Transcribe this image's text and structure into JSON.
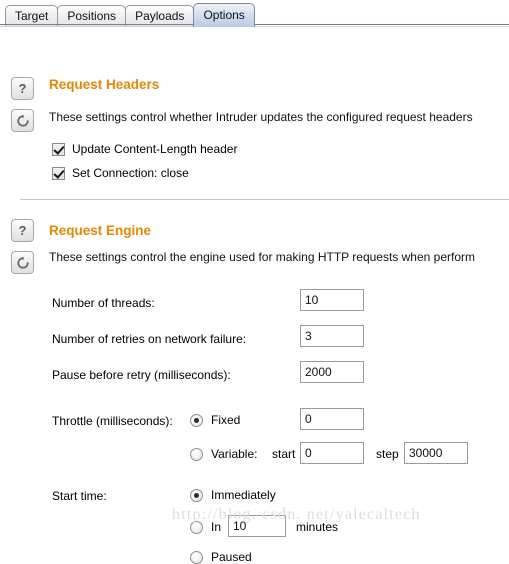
{
  "tabs": [
    {
      "label": "Target",
      "selected": false
    },
    {
      "label": "Positions",
      "selected": false
    },
    {
      "label": "Payloads",
      "selected": false
    },
    {
      "label": "Options",
      "selected": true
    }
  ],
  "icons": {
    "help": "?",
    "help_name": "help-question-icon",
    "reset_name": "refresh-reset-icon"
  },
  "request_headers": {
    "title": "Request Headers",
    "description": "These settings control whether Intruder updates the configured request headers",
    "checkboxes": [
      {
        "label": "Update Content-Length header",
        "checked": true
      },
      {
        "label": "Set Connection: close",
        "checked": true
      }
    ]
  },
  "request_engine": {
    "title": "Request Engine",
    "description": "These settings control the engine used for making HTTP requests when perform",
    "fields": [
      {
        "label": "Number of threads:",
        "value": "10"
      },
      {
        "label": "Number of retries on network failure:",
        "value": "3"
      },
      {
        "label": "Pause before retry (milliseconds):",
        "value": "2000"
      }
    ],
    "throttle": {
      "label": "Throttle (milliseconds):",
      "fixed_label": "Fixed",
      "fixed_selected": true,
      "fixed_value": "0",
      "variable_label": "Variable:",
      "variable_selected": false,
      "start_label": "start",
      "start_value": "0",
      "step_label": "step",
      "step_value": "30000"
    },
    "start_time": {
      "label": "Start time:",
      "options": [
        {
          "label": "Immediately",
          "selected": true
        },
        {
          "label": "In",
          "selected": false,
          "value": "10",
          "suffix": "minutes"
        },
        {
          "label": "Paused",
          "selected": false
        }
      ]
    }
  },
  "watermark": "http://blog. csdn. net/yalecaltech",
  "colors": {
    "accent": "#e58700",
    "tab_selected": "#cfdcea",
    "border": "#9b9b9b"
  }
}
